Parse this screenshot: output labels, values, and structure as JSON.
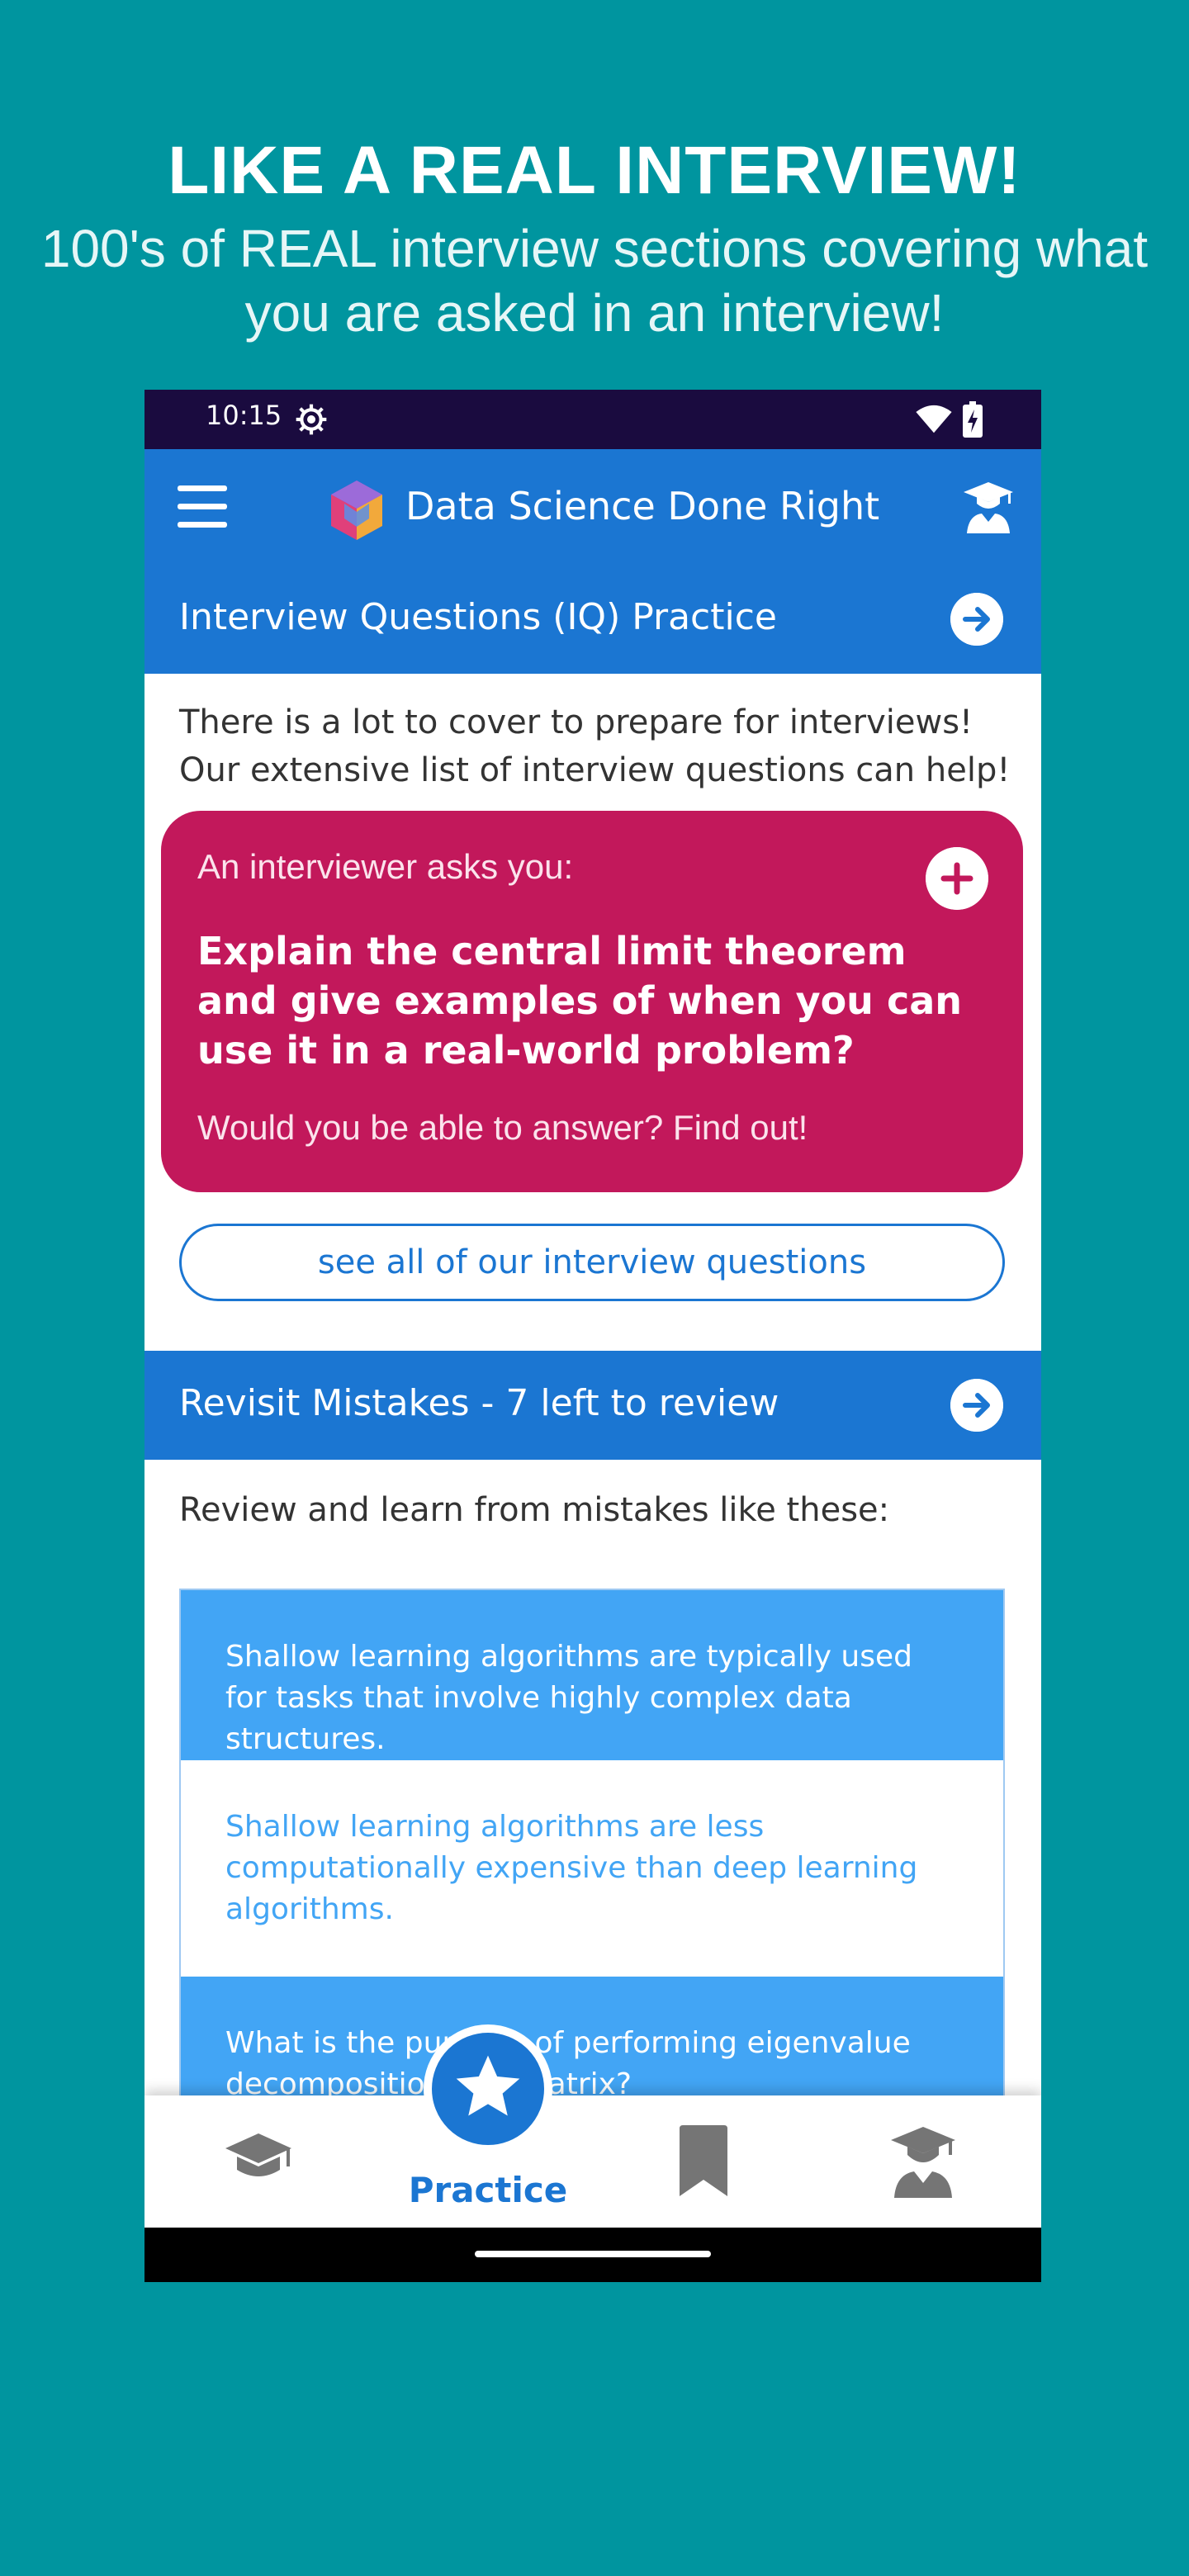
{
  "promo": {
    "title": "LIKE A REAL INTERVIEW!",
    "subtitle": "100's of REAL interview sections covering what you are asked in an interview!"
  },
  "status_bar": {
    "time": "10:15"
  },
  "app_bar": {
    "title": "Data Science Done Right"
  },
  "iq_section": {
    "header": "Interview Questions (IQ) Practice",
    "intro": "There is a lot to cover to prepare for interviews! Our extensive list of interview questions can help!",
    "card": {
      "intro": "An interviewer asks you:",
      "question": "Explain the central limit theorem and give examples of when you can use it in a real-world problem?",
      "footer": "Would you be able to answer? Find out!"
    },
    "see_all_button": "see all of our interview questions"
  },
  "mistakes_section": {
    "header": "Revisit Mistakes - 7 left to review",
    "intro": "Review and learn from mistakes like these:",
    "items": [
      "Shallow learning algorithms are typically used for tasks that involve highly complex data structures.",
      "Shallow learning algorithms are less computationally expensive than deep learning algorithms.",
      "What is the purpose of performing eigenvalue decomposition of a matrix?"
    ]
  },
  "bottom_nav": {
    "active_label": "Practice"
  },
  "colors": {
    "background": "#00959f",
    "primary": "#1b76d2",
    "card": "#c2185b",
    "item_blue": "#42a5f5",
    "status_bar": "#1a0b3f"
  },
  "icons": [
    "settings-icon",
    "wifi-icon",
    "battery-icon",
    "menu-icon",
    "app-logo",
    "graduate-icon",
    "arrow-right-icon",
    "plus-icon",
    "school-cap-icon",
    "star-icon",
    "bookmark-icon",
    "profile-icon"
  ]
}
